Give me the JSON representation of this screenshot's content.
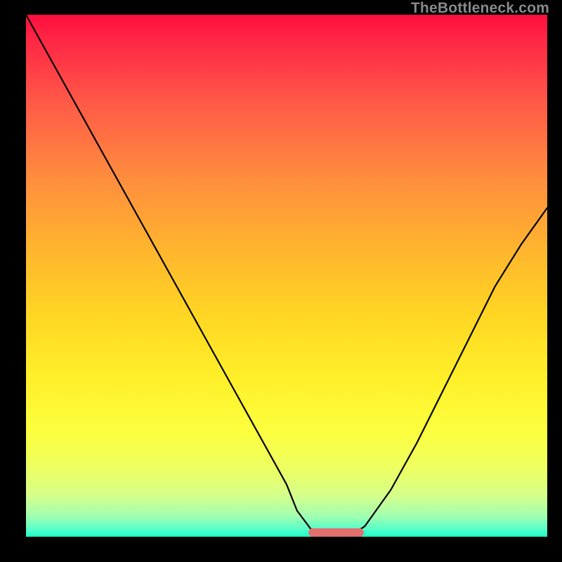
{
  "watermark": "TheBottleneck.com",
  "chart_data": {
    "type": "line",
    "title": "",
    "xlabel": "",
    "ylabel": "",
    "xlim": [
      0,
      100
    ],
    "ylim": [
      0,
      100
    ],
    "series": [
      {
        "name": "curve",
        "x": [
          0,
          5,
          10,
          15,
          20,
          25,
          30,
          35,
          40,
          45,
          50,
          52,
          55,
          58,
          60,
          62,
          65,
          70,
          75,
          80,
          85,
          90,
          95,
          100
        ],
        "values": [
          100,
          91,
          82,
          73,
          64,
          55,
          46,
          37,
          28,
          19,
          10,
          5,
          1,
          0,
          0,
          0,
          2,
          9,
          18,
          28,
          38,
          48,
          56,
          63
        ]
      }
    ],
    "flat_region": {
      "x_start": 55,
      "x_end": 64,
      "y": 0
    },
    "flat_region_color": "#e16f6e",
    "gradient_stops": [
      {
        "pos": 0.0,
        "color": "#ff0e3e"
      },
      {
        "pos": 0.05,
        "color": "#ff2746"
      },
      {
        "pos": 0.17,
        "color": "#ff5a47"
      },
      {
        "pos": 0.31,
        "color": "#ff8c3e"
      },
      {
        "pos": 0.45,
        "color": "#ffb52e"
      },
      {
        "pos": 0.58,
        "color": "#ffd723"
      },
      {
        "pos": 0.7,
        "color": "#fff02a"
      },
      {
        "pos": 0.8,
        "color": "#fcff3f"
      },
      {
        "pos": 0.87,
        "color": "#edff62"
      },
      {
        "pos": 0.92,
        "color": "#d6ff8a"
      },
      {
        "pos": 0.96,
        "color": "#a2ffb0"
      },
      {
        "pos": 0.985,
        "color": "#5affc8"
      },
      {
        "pos": 1.0,
        "color": "#1affc5"
      }
    ]
  }
}
